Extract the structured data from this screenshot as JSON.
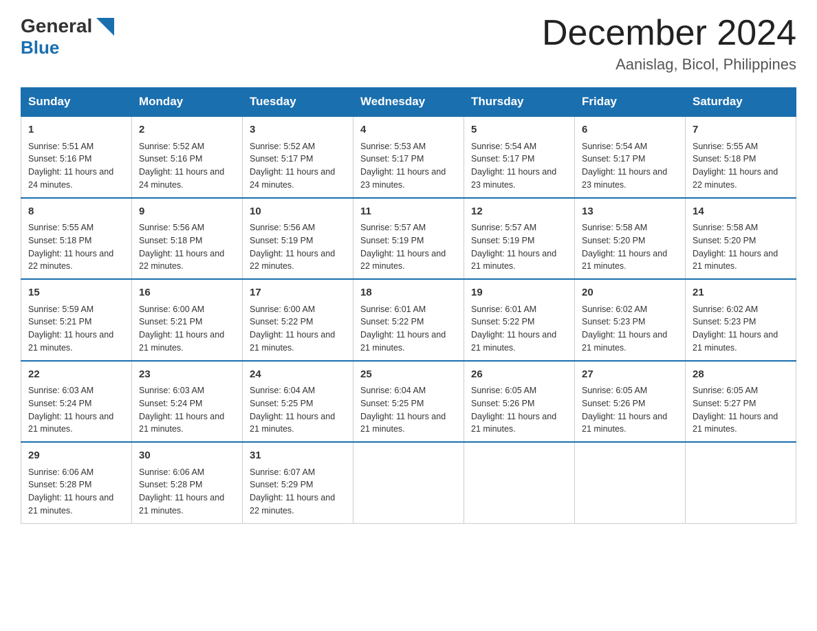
{
  "header": {
    "logo_general": "General",
    "logo_blue": "Blue",
    "month_title": "December 2024",
    "location": "Aanislag, Bicol, Philippines"
  },
  "columns": [
    "Sunday",
    "Monday",
    "Tuesday",
    "Wednesday",
    "Thursday",
    "Friday",
    "Saturday"
  ],
  "weeks": [
    [
      {
        "day": "1",
        "sunrise": "Sunrise: 5:51 AM",
        "sunset": "Sunset: 5:16 PM",
        "daylight": "Daylight: 11 hours and 24 minutes."
      },
      {
        "day": "2",
        "sunrise": "Sunrise: 5:52 AM",
        "sunset": "Sunset: 5:16 PM",
        "daylight": "Daylight: 11 hours and 24 minutes."
      },
      {
        "day": "3",
        "sunrise": "Sunrise: 5:52 AM",
        "sunset": "Sunset: 5:17 PM",
        "daylight": "Daylight: 11 hours and 24 minutes."
      },
      {
        "day": "4",
        "sunrise": "Sunrise: 5:53 AM",
        "sunset": "Sunset: 5:17 PM",
        "daylight": "Daylight: 11 hours and 23 minutes."
      },
      {
        "day": "5",
        "sunrise": "Sunrise: 5:54 AM",
        "sunset": "Sunset: 5:17 PM",
        "daylight": "Daylight: 11 hours and 23 minutes."
      },
      {
        "day": "6",
        "sunrise": "Sunrise: 5:54 AM",
        "sunset": "Sunset: 5:17 PM",
        "daylight": "Daylight: 11 hours and 23 minutes."
      },
      {
        "day": "7",
        "sunrise": "Sunrise: 5:55 AM",
        "sunset": "Sunset: 5:18 PM",
        "daylight": "Daylight: 11 hours and 22 minutes."
      }
    ],
    [
      {
        "day": "8",
        "sunrise": "Sunrise: 5:55 AM",
        "sunset": "Sunset: 5:18 PM",
        "daylight": "Daylight: 11 hours and 22 minutes."
      },
      {
        "day": "9",
        "sunrise": "Sunrise: 5:56 AM",
        "sunset": "Sunset: 5:18 PM",
        "daylight": "Daylight: 11 hours and 22 minutes."
      },
      {
        "day": "10",
        "sunrise": "Sunrise: 5:56 AM",
        "sunset": "Sunset: 5:19 PM",
        "daylight": "Daylight: 11 hours and 22 minutes."
      },
      {
        "day": "11",
        "sunrise": "Sunrise: 5:57 AM",
        "sunset": "Sunset: 5:19 PM",
        "daylight": "Daylight: 11 hours and 22 minutes."
      },
      {
        "day": "12",
        "sunrise": "Sunrise: 5:57 AM",
        "sunset": "Sunset: 5:19 PM",
        "daylight": "Daylight: 11 hours and 21 minutes."
      },
      {
        "day": "13",
        "sunrise": "Sunrise: 5:58 AM",
        "sunset": "Sunset: 5:20 PM",
        "daylight": "Daylight: 11 hours and 21 minutes."
      },
      {
        "day": "14",
        "sunrise": "Sunrise: 5:58 AM",
        "sunset": "Sunset: 5:20 PM",
        "daylight": "Daylight: 11 hours and 21 minutes."
      }
    ],
    [
      {
        "day": "15",
        "sunrise": "Sunrise: 5:59 AM",
        "sunset": "Sunset: 5:21 PM",
        "daylight": "Daylight: 11 hours and 21 minutes."
      },
      {
        "day": "16",
        "sunrise": "Sunrise: 6:00 AM",
        "sunset": "Sunset: 5:21 PM",
        "daylight": "Daylight: 11 hours and 21 minutes."
      },
      {
        "day": "17",
        "sunrise": "Sunrise: 6:00 AM",
        "sunset": "Sunset: 5:22 PM",
        "daylight": "Daylight: 11 hours and 21 minutes."
      },
      {
        "day": "18",
        "sunrise": "Sunrise: 6:01 AM",
        "sunset": "Sunset: 5:22 PM",
        "daylight": "Daylight: 11 hours and 21 minutes."
      },
      {
        "day": "19",
        "sunrise": "Sunrise: 6:01 AM",
        "sunset": "Sunset: 5:22 PM",
        "daylight": "Daylight: 11 hours and 21 minutes."
      },
      {
        "day": "20",
        "sunrise": "Sunrise: 6:02 AM",
        "sunset": "Sunset: 5:23 PM",
        "daylight": "Daylight: 11 hours and 21 minutes."
      },
      {
        "day": "21",
        "sunrise": "Sunrise: 6:02 AM",
        "sunset": "Sunset: 5:23 PM",
        "daylight": "Daylight: 11 hours and 21 minutes."
      }
    ],
    [
      {
        "day": "22",
        "sunrise": "Sunrise: 6:03 AM",
        "sunset": "Sunset: 5:24 PM",
        "daylight": "Daylight: 11 hours and 21 minutes."
      },
      {
        "day": "23",
        "sunrise": "Sunrise: 6:03 AM",
        "sunset": "Sunset: 5:24 PM",
        "daylight": "Daylight: 11 hours and 21 minutes."
      },
      {
        "day": "24",
        "sunrise": "Sunrise: 6:04 AM",
        "sunset": "Sunset: 5:25 PM",
        "daylight": "Daylight: 11 hours and 21 minutes."
      },
      {
        "day": "25",
        "sunrise": "Sunrise: 6:04 AM",
        "sunset": "Sunset: 5:25 PM",
        "daylight": "Daylight: 11 hours and 21 minutes."
      },
      {
        "day": "26",
        "sunrise": "Sunrise: 6:05 AM",
        "sunset": "Sunset: 5:26 PM",
        "daylight": "Daylight: 11 hours and 21 minutes."
      },
      {
        "day": "27",
        "sunrise": "Sunrise: 6:05 AM",
        "sunset": "Sunset: 5:26 PM",
        "daylight": "Daylight: 11 hours and 21 minutes."
      },
      {
        "day": "28",
        "sunrise": "Sunrise: 6:05 AM",
        "sunset": "Sunset: 5:27 PM",
        "daylight": "Daylight: 11 hours and 21 minutes."
      }
    ],
    [
      {
        "day": "29",
        "sunrise": "Sunrise: 6:06 AM",
        "sunset": "Sunset: 5:28 PM",
        "daylight": "Daylight: 11 hours and 21 minutes."
      },
      {
        "day": "30",
        "sunrise": "Sunrise: 6:06 AM",
        "sunset": "Sunset: 5:28 PM",
        "daylight": "Daylight: 11 hours and 21 minutes."
      },
      {
        "day": "31",
        "sunrise": "Sunrise: 6:07 AM",
        "sunset": "Sunset: 5:29 PM",
        "daylight": "Daylight: 11 hours and 22 minutes."
      },
      {
        "day": "",
        "sunrise": "",
        "sunset": "",
        "daylight": ""
      },
      {
        "day": "",
        "sunrise": "",
        "sunset": "",
        "daylight": ""
      },
      {
        "day": "",
        "sunrise": "",
        "sunset": "",
        "daylight": ""
      },
      {
        "day": "",
        "sunrise": "",
        "sunset": "",
        "daylight": ""
      }
    ]
  ]
}
